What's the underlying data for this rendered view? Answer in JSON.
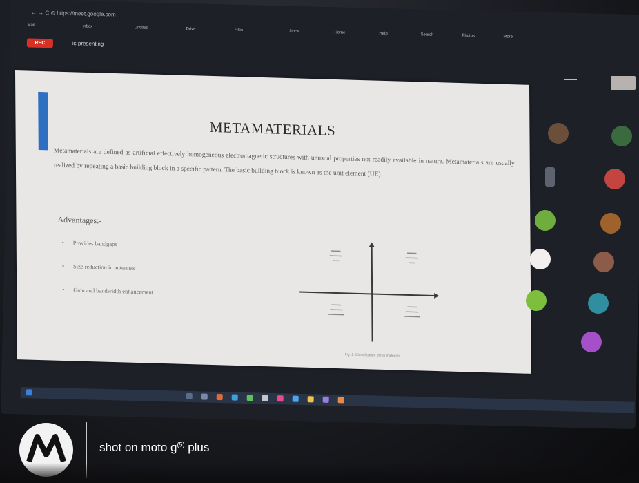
{
  "browser": {
    "address": "← → C  ⊙  https://meet.google.com",
    "bookmarks": [
      "Mail",
      "Inbox",
      "Untitled",
      "Drive",
      "Files",
      "Docs",
      "Home",
      "Help",
      "Search",
      "Photos",
      "More"
    ]
  },
  "meet": {
    "presenting_label": "is presenting",
    "rec_label": "REC"
  },
  "slide": {
    "title": "METAMATERIALS",
    "paragraph": "Metamaterials are defined as artificial effectively homogeneous electromagnetic structures with unusual properties not readily available in nature. Metamaterials are usually realized by repeating a basic building block in a specific pattern. The basic building block is known as the unit element (UE).",
    "advantages_heading": "Advantages:-",
    "bullets": [
      "Provides bandgaps",
      "Size reduction in antennas",
      "Gain and bandwidth enhancement"
    ],
    "caption": "Fig. 1: Classification of the materials"
  },
  "watermark": {
    "text": "shot on moto g",
    "superscript": "(5)",
    "suffix": " plus"
  },
  "colors": {
    "slide_bg": "#e9e6e6",
    "accent_bar": "#2f6fc2",
    "record_red": "#d93025",
    "taskbar": "#2a3447"
  },
  "icons": [
    "motorola-logo-icon",
    "bullet-icon",
    "arrow-icon"
  ]
}
